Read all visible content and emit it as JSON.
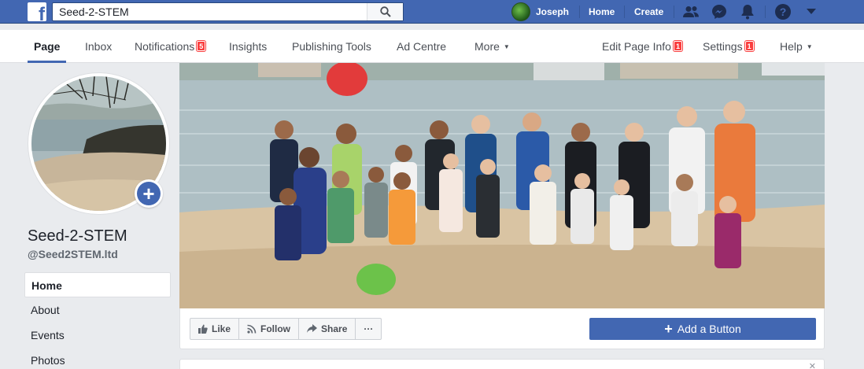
{
  "topbar": {
    "search": {
      "value": "Seed-2-STEM"
    },
    "user_name": "Joseph",
    "links": {
      "home": "Home",
      "create": "Create"
    },
    "icons": [
      "friends-icon",
      "messenger-icon",
      "notifications-bell-icon",
      "help-icon",
      "dropdown-caret-icon"
    ]
  },
  "pagenav": {
    "tabs": [
      {
        "label": "Page",
        "active": true
      },
      {
        "label": "Inbox"
      },
      {
        "label": "Notifications",
        "badge": "5"
      },
      {
        "label": "Insights"
      },
      {
        "label": "Publishing Tools"
      },
      {
        "label": "Ad Centre"
      },
      {
        "label": "More"
      }
    ],
    "right": [
      {
        "label": "Edit Page Info",
        "badge": "1"
      },
      {
        "label": "Settings",
        "badge": "1"
      },
      {
        "label": "Help"
      }
    ]
  },
  "profile": {
    "name": "Seed-2-STEM",
    "handle": "@Seed2STEM.ltd"
  },
  "side_menu": [
    "Home",
    "About",
    "Events",
    "Photos"
  ],
  "actions": {
    "like": "Like",
    "follow": "Follow",
    "share": "Share",
    "more": "···",
    "add_button": "Add a Button"
  },
  "colors": {
    "brand_blue": "#4267b2",
    "badge_red": "#fa3e3e",
    "background": "#e9ebee"
  }
}
